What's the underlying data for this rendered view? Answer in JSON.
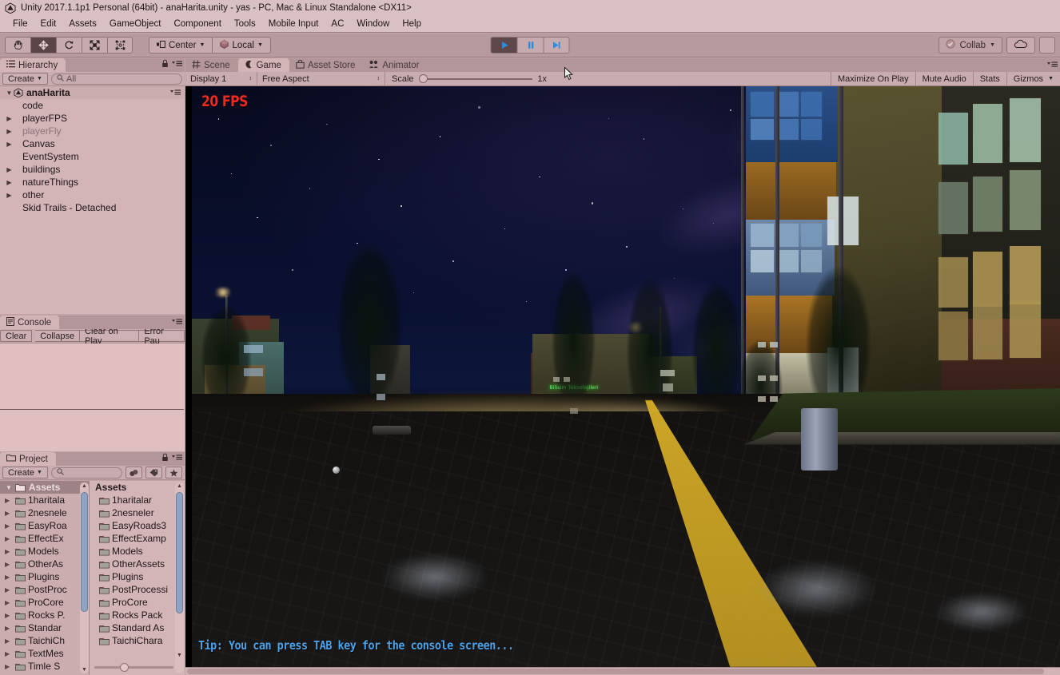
{
  "window": {
    "title": "Unity 2017.1.1p1 Personal (64bit) - anaHarita.unity - yas - PC, Mac & Linux Standalone <DX11>"
  },
  "menubar": {
    "items": [
      "File",
      "Edit",
      "Assets",
      "GameObject",
      "Component",
      "Tools",
      "Mobile Input",
      "AC",
      "Window",
      "Help"
    ]
  },
  "toolbar": {
    "tools": [
      {
        "name": "hand-tool",
        "active": false
      },
      {
        "name": "move-tool",
        "active": true
      },
      {
        "name": "rotate-tool",
        "active": false
      },
      {
        "name": "scale-tool",
        "active": false
      },
      {
        "name": "rect-tool",
        "active": false
      }
    ],
    "pivot_label": "Center",
    "space_label": "Local",
    "play_label": "▶",
    "pause_label": "⏸",
    "step_label": "⏭",
    "collab_label": "Collab",
    "cloud_label": "cloud-icon",
    "account_label": "account-icon"
  },
  "hierarchy": {
    "tab_label": "Hierarchy",
    "create_label": "Create",
    "search_placeholder": "All",
    "root": "anaHarita",
    "items": [
      {
        "label": "code",
        "expandable": false,
        "dim": false
      },
      {
        "label": "playerFPS",
        "expandable": true,
        "dim": false
      },
      {
        "label": "playerFly",
        "expandable": true,
        "dim": true
      },
      {
        "label": "Canvas",
        "expandable": true,
        "dim": false
      },
      {
        "label": "EventSystem",
        "expandable": false,
        "dim": false
      },
      {
        "label": "buildings",
        "expandable": true,
        "dim": false
      },
      {
        "label": "natureThings",
        "expandable": true,
        "dim": false
      },
      {
        "label": "other",
        "expandable": true,
        "dim": false
      },
      {
        "label": "Skid Trails - Detached",
        "expandable": false,
        "dim": false
      }
    ]
  },
  "console": {
    "tab_label": "Console",
    "buttons": [
      "Clear",
      "Collapse",
      "Clear on Play",
      "Error Pau"
    ]
  },
  "project": {
    "tab_label": "Project",
    "create_label": "Create",
    "search_placeholder": "",
    "tree_header": "Assets",
    "list_header": "Assets",
    "tree_items": [
      "1haritala",
      "2nesnele",
      "EasyRoa",
      "EffectEx",
      "Models",
      "OtherAs",
      "Plugins",
      "PostProc",
      "ProCore",
      "Rocks P.",
      "Standar",
      "TaichiCh",
      "TextMes",
      "Timle S"
    ],
    "list_items": [
      "1haritalar",
      "2nesneler",
      "EasyRoads3",
      "EffectExamp",
      "Models",
      "OtherAssets",
      "Plugins",
      "PostProcessi",
      "ProCore",
      "Rocks Pack",
      "Standard As",
      "TaichiChara"
    ]
  },
  "gameview": {
    "tabs": [
      {
        "label": "Scene",
        "icon": "grid-icon",
        "active": false
      },
      {
        "label": "Game",
        "icon": "gamepad-icon",
        "active": true
      },
      {
        "label": "Asset Store",
        "icon": "store-icon",
        "active": false
      },
      {
        "label": "Animator",
        "icon": "animator-icon",
        "active": false
      }
    ],
    "display_label": "Display 1",
    "aspect_label": "Free Aspect",
    "scale_label": "Scale",
    "scale_value": "1x",
    "maximize_label": "Maximize On Play",
    "mute_label": "Mute Audio",
    "stats_label": "Stats",
    "gizmos_label": "Gizmos"
  },
  "scene": {
    "fps_label": "20 FPS",
    "fps_color": "#ee2a22",
    "tip_label": "Tip: You can press TAB key for the console screen...",
    "tip_color": "#4da2e8",
    "shop_sign": "Bilisim Teknolojileri",
    "shop_sign_color": "#6ef06e"
  }
}
